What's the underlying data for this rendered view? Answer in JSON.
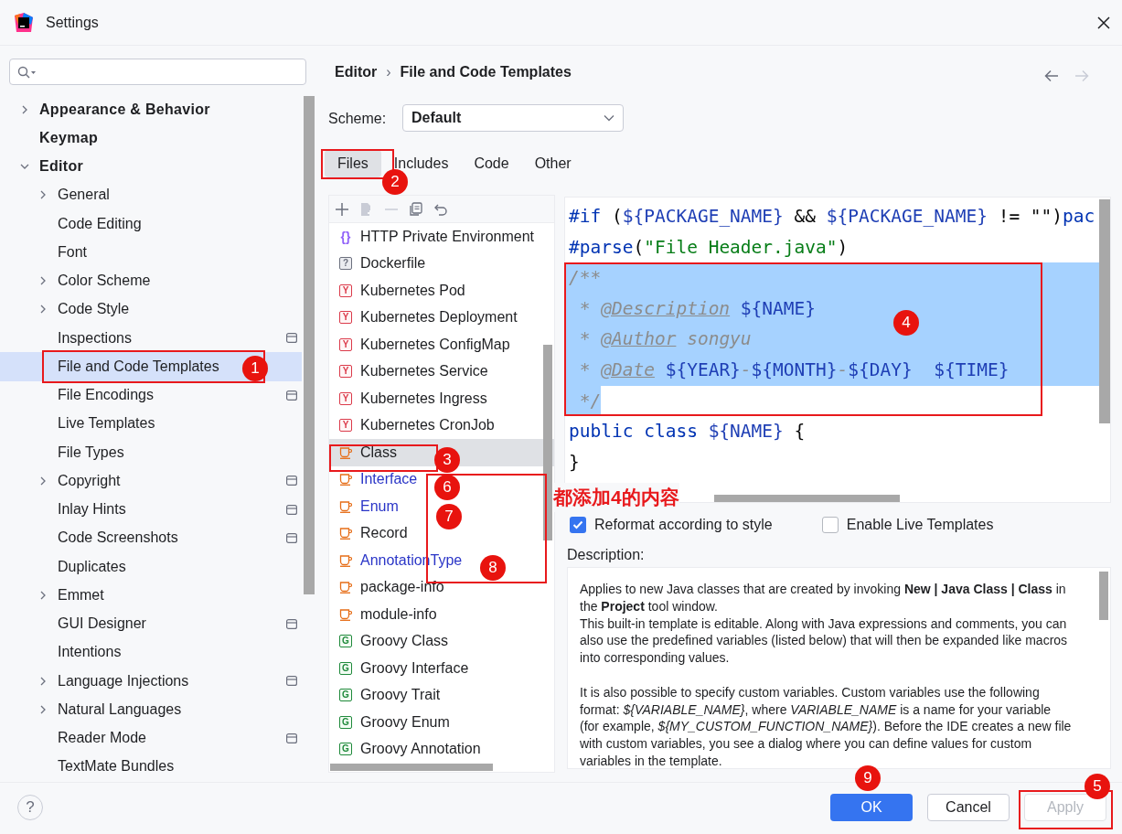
{
  "window": {
    "title": "Settings"
  },
  "sidebar": {
    "items": [
      {
        "label": "Appearance & Behavior",
        "kind": "group",
        "expanded": false,
        "selected": false,
        "scope_icon": false
      },
      {
        "label": "Keymap",
        "kind": "leaf",
        "selected": false,
        "scope_icon": false
      },
      {
        "label": "Editor",
        "kind": "group",
        "expanded": true,
        "selected": false,
        "scope_icon": false,
        "children": [
          {
            "label": "General",
            "kind": "group",
            "expanded": false,
            "selected": false,
            "scope_icon": false
          },
          {
            "label": "Code Editing",
            "kind": "leaf",
            "selected": false,
            "scope_icon": false
          },
          {
            "label": "Font",
            "kind": "leaf",
            "selected": false,
            "scope_icon": false
          },
          {
            "label": "Color Scheme",
            "kind": "group",
            "expanded": false,
            "selected": false,
            "scope_icon": false
          },
          {
            "label": "Code Style",
            "kind": "group",
            "expanded": false,
            "selected": false,
            "scope_icon": false
          },
          {
            "label": "Inspections",
            "kind": "leaf",
            "selected": false,
            "scope_icon": true
          },
          {
            "label": "File and Code Templates",
            "kind": "leaf",
            "selected": true,
            "scope_icon": false
          },
          {
            "label": "File Encodings",
            "kind": "leaf",
            "selected": false,
            "scope_icon": true
          },
          {
            "label": "Live Templates",
            "kind": "leaf",
            "selected": false,
            "scope_icon": false
          },
          {
            "label": "File Types",
            "kind": "leaf",
            "selected": false,
            "scope_icon": false
          },
          {
            "label": "Copyright",
            "kind": "group",
            "expanded": false,
            "selected": false,
            "scope_icon": true
          },
          {
            "label": "Inlay Hints",
            "kind": "leaf",
            "selected": false,
            "scope_icon": true
          },
          {
            "label": "Code Screenshots",
            "kind": "leaf",
            "selected": false,
            "scope_icon": true
          },
          {
            "label": "Duplicates",
            "kind": "leaf",
            "selected": false,
            "scope_icon": false
          },
          {
            "label": "Emmet",
            "kind": "group",
            "expanded": false,
            "selected": false,
            "scope_icon": false
          },
          {
            "label": "GUI Designer",
            "kind": "leaf",
            "selected": false,
            "scope_icon": true
          },
          {
            "label": "Intentions",
            "kind": "leaf",
            "selected": false,
            "scope_icon": false
          },
          {
            "label": "Language Injections",
            "kind": "group",
            "expanded": false,
            "selected": false,
            "scope_icon": true
          },
          {
            "label": "Natural Languages",
            "kind": "group",
            "expanded": false,
            "selected": false,
            "scope_icon": false
          },
          {
            "label": "Reader Mode",
            "kind": "leaf",
            "selected": false,
            "scope_icon": true
          },
          {
            "label": "TextMate Bundles",
            "kind": "leaf",
            "selected": false,
            "scope_icon": false
          }
        ]
      }
    ]
  },
  "breadcrumb": {
    "items": [
      "Editor",
      "File and Code Templates"
    ],
    "separator": "›"
  },
  "scheme": {
    "label": "Scheme:",
    "value": "Default"
  },
  "tabs": [
    {
      "label": "Files",
      "selected": true
    },
    {
      "label": "Includes",
      "selected": false
    },
    {
      "label": "Code",
      "selected": false
    },
    {
      "label": "Other",
      "selected": false
    }
  ],
  "toolbar": [
    {
      "kind": "add",
      "disabled": false
    },
    {
      "kind": "add-child",
      "disabled": true
    },
    {
      "kind": "remove",
      "disabled": true
    },
    {
      "kind": "copy",
      "disabled": false
    },
    {
      "kind": "reset",
      "disabled": false
    }
  ],
  "templates": [
    {
      "label": "HTTP Private Environment",
      "kind": "braces",
      "icon_text": "{}",
      "selected": false,
      "modified": false
    },
    {
      "label": "Dockerfile",
      "kind": "unknown",
      "icon_text": "?",
      "selected": false,
      "modified": false
    },
    {
      "label": "Kubernetes Pod",
      "kind": "yaml",
      "icon_text": "Y",
      "selected": false,
      "modified": false
    },
    {
      "label": "Kubernetes Deployment",
      "kind": "yaml",
      "icon_text": "Y",
      "selected": false,
      "modified": false
    },
    {
      "label": "Kubernetes ConfigMap",
      "kind": "yaml",
      "icon_text": "Y",
      "selected": false,
      "modified": false
    },
    {
      "label": "Kubernetes Service",
      "kind": "yaml",
      "icon_text": "Y",
      "selected": false,
      "modified": false
    },
    {
      "label": "Kubernetes Ingress",
      "kind": "yaml",
      "icon_text": "Y",
      "selected": false,
      "modified": false
    },
    {
      "label": "Kubernetes CronJob",
      "kind": "yaml",
      "icon_text": "Y",
      "selected": false,
      "modified": false
    },
    {
      "label": "Class",
      "kind": "java",
      "selected": true,
      "modified": false
    },
    {
      "label": "Interface",
      "kind": "java",
      "selected": false,
      "modified": true
    },
    {
      "label": "Enum",
      "kind": "java",
      "selected": false,
      "modified": true
    },
    {
      "label": "Record",
      "kind": "java",
      "selected": false,
      "modified": false
    },
    {
      "label": "AnnotationType",
      "kind": "java",
      "selected": false,
      "modified": true
    },
    {
      "label": "package-info",
      "kind": "java",
      "selected": false,
      "modified": false
    },
    {
      "label": "module-info",
      "kind": "java",
      "selected": false,
      "modified": false
    },
    {
      "label": "Groovy Class",
      "kind": "groovy",
      "icon_text": "G",
      "selected": false,
      "modified": false
    },
    {
      "label": "Groovy Interface",
      "kind": "groovy",
      "icon_text": "G",
      "selected": false,
      "modified": false
    },
    {
      "label": "Groovy Trait",
      "kind": "groovy",
      "icon_text": "G",
      "selected": false,
      "modified": false
    },
    {
      "label": "Groovy Enum",
      "kind": "groovy",
      "icon_text": "G",
      "selected": false,
      "modified": false
    },
    {
      "label": "Groovy Annotation",
      "kind": "groovy",
      "icon_text": "G",
      "selected": false,
      "modified": false
    }
  ],
  "editor": {
    "lines": [
      {
        "selected": false,
        "segments": [
          {
            "kind": "directive",
            "text": "#if"
          },
          {
            "kind": "plain",
            "text": " ("
          },
          {
            "kind": "var",
            "text": "${PACKAGE_NAME}"
          },
          {
            "kind": "plain",
            "text": " && "
          },
          {
            "kind": "var",
            "text": "${PACKAGE_NAME}"
          },
          {
            "kind": "plain",
            "text": " != \"\")"
          },
          {
            "kind": "directive",
            "text": "pac"
          }
        ]
      },
      {
        "selected": false,
        "segments": [
          {
            "kind": "directive",
            "text": "#parse"
          },
          {
            "kind": "plain",
            "text": "("
          },
          {
            "kind": "string",
            "text": "\"File Header.java\""
          },
          {
            "kind": "plain",
            "text": ")"
          }
        ]
      },
      {
        "selected": true,
        "segments": [
          {
            "kind": "comment",
            "text": "/**"
          }
        ]
      },
      {
        "selected": true,
        "segments": [
          {
            "kind": "comment",
            "text": " * "
          },
          {
            "kind": "tag",
            "text": "@Description"
          },
          {
            "kind": "var",
            "text": " ${NAME}"
          }
        ]
      },
      {
        "selected": true,
        "segments": [
          {
            "kind": "comment",
            "text": " * "
          },
          {
            "kind": "tag",
            "text": "@Author"
          },
          {
            "kind": "comment",
            "text": " songyu"
          }
        ]
      },
      {
        "selected": true,
        "segments": [
          {
            "kind": "comment",
            "text": " * "
          },
          {
            "kind": "tag",
            "text": "@Date"
          },
          {
            "kind": "var",
            "text": " ${YEAR}"
          },
          {
            "kind": "comment",
            "text": "-"
          },
          {
            "kind": "var",
            "text": "${MONTH}"
          },
          {
            "kind": "comment",
            "text": "-"
          },
          {
            "kind": "var",
            "text": "${DAY}"
          },
          {
            "kind": "var",
            "text": "  ${TIME}"
          }
        ]
      },
      {
        "selected": false,
        "partly_selected": true,
        "segments": [
          {
            "kind": "comment",
            "text": " */"
          }
        ]
      },
      {
        "selected": false,
        "segments": [
          {
            "kind": "keyword",
            "text": "public class "
          },
          {
            "kind": "var",
            "text": "${NAME}"
          },
          {
            "kind": "plain",
            "text": " {"
          }
        ]
      },
      {
        "selected": false,
        "segments": [
          {
            "kind": "plain",
            "text": "}"
          }
        ]
      }
    ]
  },
  "options": [
    {
      "label": "Reformat according to style",
      "checked": true
    },
    {
      "label": "Enable Live Templates",
      "checked": false
    }
  ],
  "description": {
    "label": "Description:",
    "blocks": [
      [
        "Applies to new Java classes that are created by invoking **New | Java Class | Class** in the **Project** tool window.",
        "This built-in template is editable. Along with Java expressions and comments, you can also use the predefined variables (listed below) that will then be expanded like macros into corresponding values."
      ],
      [
        "It is also possible to specify custom variables. Custom variables use the following format: *${VARIABLE_NAME}*, where *VARIABLE_NAME* is a name for your variable (for example, *${MY_CUSTOM_FUNCTION_NAME}*). Before the IDE creates a new file with custom variables, you see a dialog where you can define values for custom variables in the template."
      ]
    ]
  },
  "footer": {
    "help": "?",
    "buttons": [
      {
        "label": "OK",
        "kind": "primary",
        "disabled": false
      },
      {
        "label": "Cancel",
        "kind": "normal",
        "disabled": false
      },
      {
        "label": "Apply",
        "kind": "normal",
        "disabled": true
      }
    ]
  },
  "annotations": {
    "markers": [
      "1",
      "2",
      "3",
      "4",
      "5",
      "6",
      "7",
      "8",
      "9"
    ],
    "note": "都添加4的内容"
  }
}
